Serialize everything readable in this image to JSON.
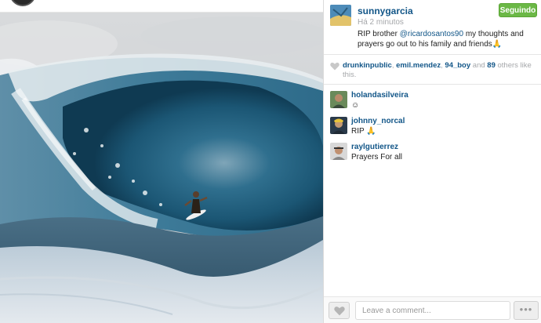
{
  "post": {
    "author": "sunnygarcia",
    "timestamp": "Há 2 minutos",
    "follow_label": "Seguindo",
    "caption_prefix": "RIP brother ",
    "caption_mention": "@ricardosantos90",
    "caption_suffix": " my thoughts and prayers go out to his family and friends🙏"
  },
  "likes": {
    "user1": "drunkinpublic",
    "sep1": ", ",
    "user2": "emil.mendez",
    "sep2": ", ",
    "user3": "94_boy",
    "and_text": " and ",
    "count": "89",
    "suffix": " others like this."
  },
  "comments": [
    {
      "user": "holandasilveira",
      "text": "☺"
    },
    {
      "user": "johnny_norcal",
      "text": "RIP 🙏"
    },
    {
      "user": "raylgutierrez",
      "text": "Prayers For all"
    }
  ],
  "footer": {
    "comment_placeholder": "Leave a comment...",
    "more_label": "•••"
  },
  "colors": {
    "link": "#125688",
    "follow_green": "#6bb846",
    "muted": "#a5a7aa"
  }
}
